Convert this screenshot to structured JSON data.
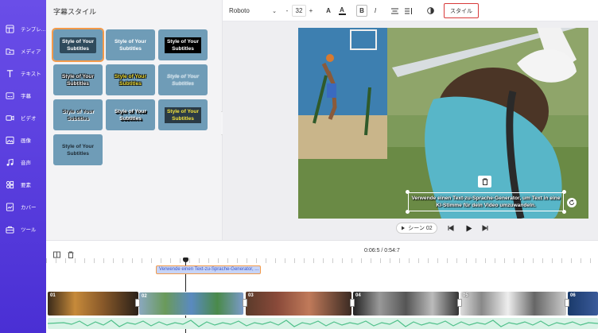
{
  "sidebar": {
    "items": [
      {
        "label": "テンプレ...",
        "icon": "template-icon"
      },
      {
        "label": "メディア",
        "icon": "media-folder-icon"
      },
      {
        "label": "テキスト",
        "icon": "text-icon"
      },
      {
        "label": "字幕",
        "icon": "subtitle-icon"
      },
      {
        "label": "ビデオ",
        "icon": "video-icon"
      },
      {
        "label": "画像",
        "icon": "image-icon"
      },
      {
        "label": "音声",
        "icon": "music-icon"
      },
      {
        "label": "要素",
        "icon": "elements-icon"
      },
      {
        "label": "カバー",
        "icon": "cover-icon"
      },
      {
        "label": "ツール",
        "icon": "tools-icon"
      }
    ]
  },
  "panel": {
    "title": "字幕スタイル",
    "style_cards": [
      {
        "text": "Style of Your\nSubtitles",
        "variant": "dark-box",
        "selected": true
      },
      {
        "text": "Style of Your\nSubtitles",
        "variant": "plain"
      },
      {
        "text": "Style of Your\nSubtitles",
        "variant": "black-box"
      },
      {
        "text": "Style of Your\nSubtitles",
        "variant": "outline-dark"
      },
      {
        "text": "Style of Your\nSubtitles",
        "variant": "yellow-outline"
      },
      {
        "text": "Style of Your\nSubtitles",
        "variant": "ghost"
      },
      {
        "text": "Style of Your\nSubtitles",
        "variant": "shadow"
      },
      {
        "text": "Style of Your\nSubtitles",
        "variant": "heavy-shadow"
      },
      {
        "text": "Style of Your\nSubtitles",
        "variant": "yellow-dark-box"
      },
      {
        "text": "Style of Your\nSubtitles",
        "variant": "dark-text"
      }
    ]
  },
  "toolbar": {
    "font": "Roboto",
    "font_size": "32",
    "minus": "-",
    "plus": "+",
    "text_color_glyph": "A",
    "highlight_glyph": "A",
    "bold_glyph": "B",
    "italic_glyph": "I",
    "style_button": "スタイル"
  },
  "canvas": {
    "subtitle_text": "Verwende einen Text-zu-Sprache-Generator, um Text in eine KI-Stimme für dein Video umzuwandeln.",
    "scene_label": "シーン 02"
  },
  "timeline": {
    "time": "0:06:5 / 0:54:7",
    "subtitle_clip": "Verwende einen Text-zu-Sprache-Generator, ...",
    "scene_numbers": [
      "01",
      "02",
      "03",
      "04",
      "05",
      "06"
    ]
  },
  "colors": {
    "sidebar": "#5b3fe0",
    "accent": "#5b3fe0",
    "card": "#6f9cb7",
    "selected_outline": "#f39a4a",
    "style_button_border": "#d83a3a",
    "subtitle_clip": "#c7d4f7",
    "waveform": "#6fd6a4"
  }
}
